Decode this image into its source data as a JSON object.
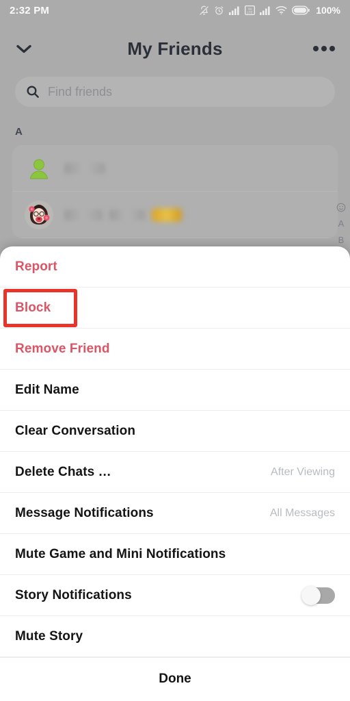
{
  "statusbar": {
    "time": "2:32 PM",
    "battery_percent": "100%",
    "icons": [
      "bell-muted-icon",
      "alarm-clock-icon",
      "signal-bars-icon",
      "volte-icon",
      "signal-bars-icon",
      "wifi-icon",
      "battery-icon"
    ]
  },
  "header": {
    "title": "My Friends",
    "back_icon": "chevron-down-icon",
    "menu_icon": "more-options-icon"
  },
  "search": {
    "placeholder": "Find friends",
    "icon": "search-icon",
    "value": ""
  },
  "friends_list": {
    "section_letter": "A",
    "rows": [
      {
        "avatar": "person-placeholder-avatar",
        "name": "",
        "name_blurred": true,
        "has_emoji": false
      },
      {
        "avatar": "bitmoji-avatar",
        "name": "",
        "name_blurred": true,
        "has_emoji": true
      }
    ]
  },
  "scrubber": {
    "items": [
      "smiley-face-icon",
      "A",
      "B"
    ]
  },
  "action_sheet": {
    "items": [
      {
        "label": "Report",
        "style": "destructive",
        "value": "",
        "control": "none"
      },
      {
        "label": "Block",
        "style": "destructive",
        "value": "",
        "control": "none",
        "highlighted": true
      },
      {
        "label": "Remove Friend",
        "style": "destructive",
        "value": "",
        "control": "none"
      },
      {
        "label": "Edit Name",
        "style": "normal",
        "value": "",
        "control": "none"
      },
      {
        "label": "Clear Conversation",
        "style": "normal",
        "value": "",
        "control": "none"
      },
      {
        "label": "Delete Chats …",
        "style": "normal",
        "value": "After Viewing",
        "control": "none"
      },
      {
        "label": "Message Notifications",
        "style": "normal",
        "value": "All Messages",
        "control": "none"
      },
      {
        "label": "Mute Game and Mini Notifications",
        "style": "normal",
        "value": "",
        "control": "none"
      },
      {
        "label": "Story Notifications",
        "style": "normal",
        "value": "",
        "control": "toggle",
        "toggle_on": false
      },
      {
        "label": "Mute Story",
        "style": "normal",
        "value": "",
        "control": "none"
      }
    ],
    "done_label": "Done"
  },
  "colors": {
    "destructive": "#dc5566",
    "highlight": "#e8342a",
    "backdrop": "#ababab",
    "sheet_bg": "#ffffff",
    "value_text": "#b6bcc0"
  }
}
